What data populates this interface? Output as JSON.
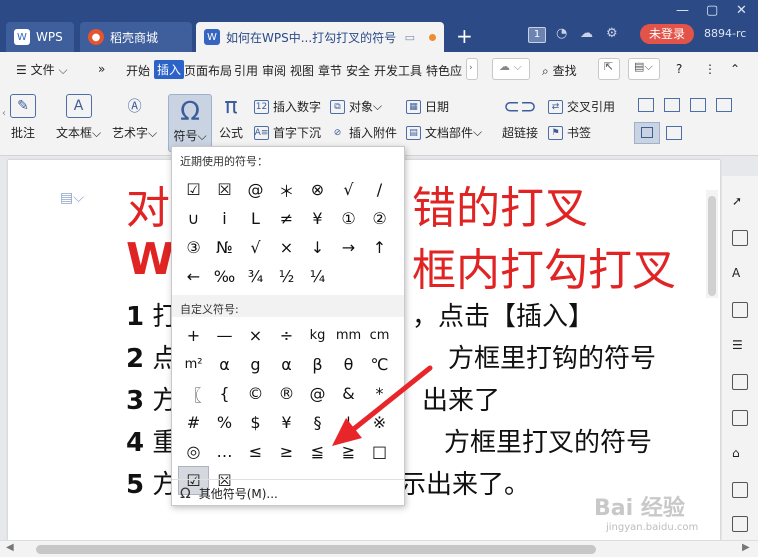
{
  "tabbar": {
    "wps_label": "WPS",
    "store_label": "稻壳商城",
    "doc_tab_title": "如何在WPS中...打勾打叉的符号",
    "new_tab": "+",
    "window_count": "1",
    "login_label": "未登录",
    "user_id": "8894-rc"
  },
  "menu": {
    "file_label": "文件",
    "items": [
      "开始",
      "插入",
      "页面布局",
      "引用",
      "审阅",
      "视图",
      "章节",
      "安全",
      "开发工具",
      "特色应"
    ],
    "search_label": "查找"
  },
  "ribbon": {
    "comment": "批注",
    "textbox": "文本框",
    "wordart": "艺术字",
    "symbol": "符号",
    "formula": "公式",
    "insert_number": "插入数字",
    "object": "对象",
    "date": "日期",
    "drop_cap": "首字下沉",
    "insert_attachment": "插入附件",
    "doc_parts": "文档部件",
    "hyperlink": "超链接",
    "cross_ref": "交叉引用",
    "bookmark": "书签"
  },
  "document": {
    "line1_left": "对",
    "line1_right": "错的打叉",
    "line2_left": "W",
    "line2_right": "框内打勾打叉",
    "step1_num": "1",
    "step1_a": "打",
    "step1_b": "，点击【插入】",
    "step2_num": "2",
    "step2_a": "点",
    "step2_b": "方框里打钩的符号",
    "step3_num": "3",
    "step3_a": "方",
    "step3_b": "出来了",
    "step4_num": "4",
    "step4_a": "重",
    "step4_b": "方框里打叉的符号",
    "step5_num": "5",
    "step5_a": "方",
    "step5_b": "示出来了。"
  },
  "symbol_popup": {
    "recent_title": "近期使用的符号：",
    "recent_symbols": [
      "☑",
      "☒",
      "@",
      "＊",
      "⊗",
      "√",
      "/",
      "∪",
      "i",
      "L",
      "≠",
      "¥",
      "①",
      "②",
      "③",
      "№",
      "√",
      "×",
      "↓",
      "→",
      "↑",
      "←",
      "‰",
      "¾",
      "½",
      "¼"
    ],
    "custom_title": "自定义符号:",
    "custom_symbols": [
      "+",
      "—",
      "×",
      "÷",
      "kg",
      "mm",
      "cm",
      "m²",
      "α",
      "g",
      "α",
      "β",
      "θ",
      "℃",
      "〖",
      "{",
      "©",
      "®",
      "@",
      "&",
      "*",
      "#",
      "%",
      "$",
      "¥",
      "§",
      "¦",
      "※",
      "◎",
      "…",
      "≤",
      "≥",
      "≦",
      "≧",
      "□",
      "☑",
      "☒"
    ],
    "highlighted_symbol": "☑",
    "more_label": "其他符号(M)..."
  },
  "colors": {
    "title_red": "#e02424",
    "tab_blue": "#2b4a86",
    "accent_blue": "#2b63c9",
    "arrow_red": "#e8262a",
    "login_red": "#e2544a"
  },
  "watermark": {
    "text": "Bai 经验",
    "sub": "jingyan.baidu.com"
  }
}
